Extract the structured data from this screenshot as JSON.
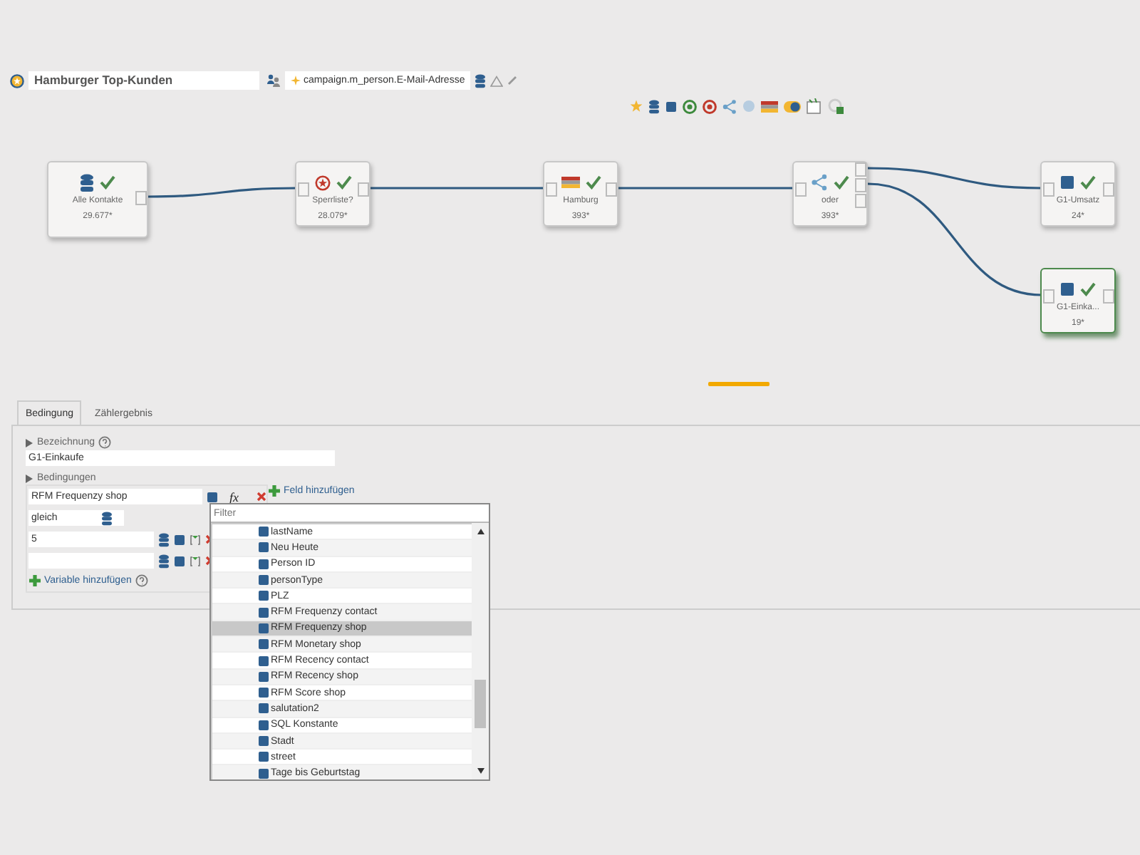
{
  "header": {
    "title": "Hamburger Top-Kunden",
    "variable": "campaign.m_person.E-Mail-Adresse"
  },
  "nodes": [
    {
      "kind": "all",
      "label": "Alle Kontakte",
      "count": "29.677*",
      "valid": true,
      "selected": false
    },
    {
      "kind": "blacklist",
      "label": "Sperrliste?",
      "count": "28.079*",
      "valid": true,
      "selected": false
    },
    {
      "kind": "region",
      "label": "Hamburg",
      "count": "393*",
      "valid": true,
      "selected": false
    },
    {
      "kind": "or",
      "label": "oder",
      "count": "393*",
      "valid": true,
      "selected": false
    },
    {
      "kind": "segment",
      "label": "G1-Umsatz",
      "count": "24*",
      "valid": true,
      "selected": false
    },
    {
      "kind": "segment",
      "label": "G1-Einka...",
      "count": "19*",
      "valid": true,
      "selected": true
    }
  ],
  "tabs": [
    {
      "label": "Bedingung",
      "selected": true
    },
    {
      "label": "Zählergebnis",
      "selected": false
    }
  ],
  "form": {
    "name_label": "Bezeichnung",
    "name_value": "G1-Einkaufe",
    "conditions_label": "Bedingungen",
    "field": "RFM Frequenzy shop",
    "function_label": "fx",
    "add_field": "Feld hinzufügen",
    "operator": "gleich",
    "values": [
      {
        "kind": "filled",
        "text": "5"
      },
      {
        "kind": "empty"
      }
    ],
    "add_variable": "Variable hinzufügen"
  },
  "dropdown": {
    "placeholder": "Filter",
    "items": [
      {
        "label": "lastName",
        "selected": false
      },
      {
        "label": "Neu Heute",
        "selected": false
      },
      {
        "label": "Person ID",
        "selected": false
      },
      {
        "label": "personType",
        "selected": false
      },
      {
        "label": "PLZ",
        "selected": false
      },
      {
        "label": "RFM Frequenzy contact",
        "selected": false
      },
      {
        "label": "RFM Frequenzy shop",
        "selected": true
      },
      {
        "label": "RFM Monetary shop",
        "selected": false
      },
      {
        "label": "RFM Recency contact",
        "selected": false
      },
      {
        "label": "RFM Recency shop",
        "selected": false
      },
      {
        "label": "RFM Score shop",
        "selected": false
      },
      {
        "label": "salutation2",
        "selected": false
      },
      {
        "label": "SQL Konstante",
        "selected": false
      },
      {
        "label": "Stadt",
        "selected": false
      },
      {
        "label": "street",
        "selected": false
      },
      {
        "label": "Tage bis Geburtstag",
        "selected": false
      }
    ]
  }
}
